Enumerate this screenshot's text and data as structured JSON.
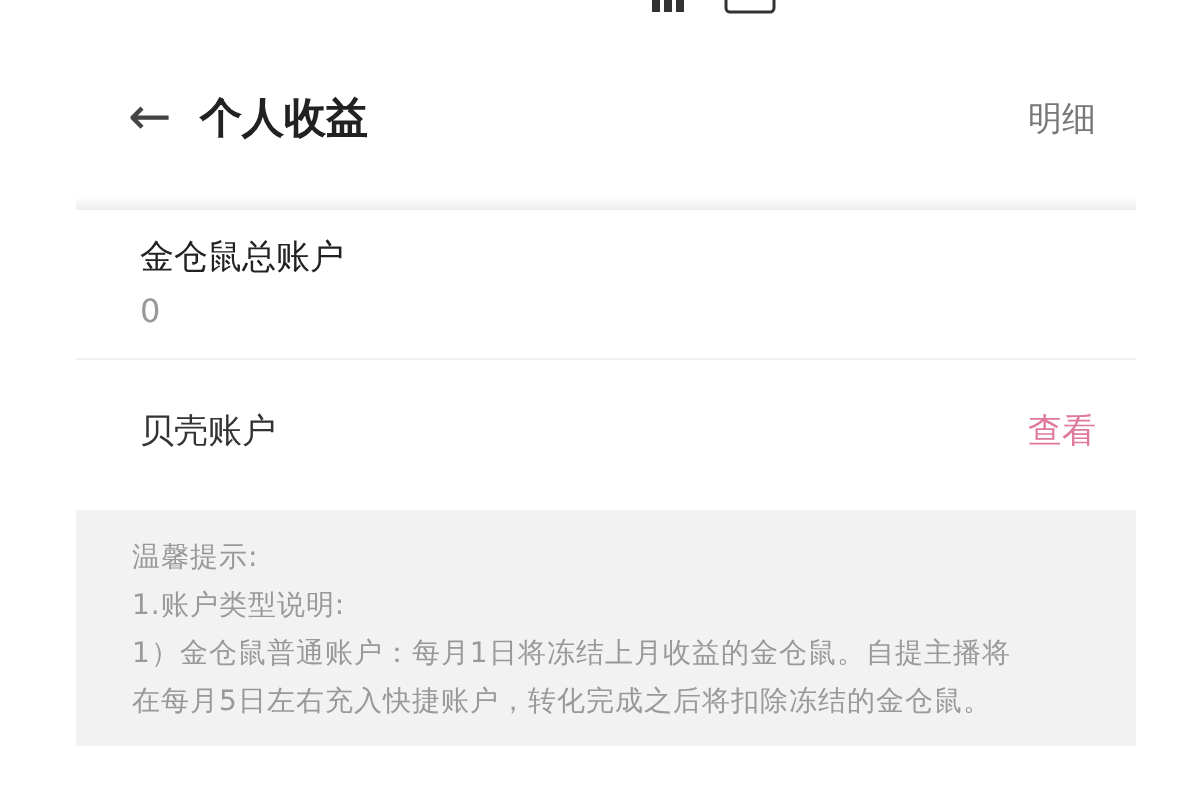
{
  "header": {
    "back": "←",
    "title": "个人收益",
    "action": "明细"
  },
  "accounts": [
    {
      "kind": "balance",
      "name": "金仓鼠总账户",
      "value": "0"
    },
    {
      "kind": "link",
      "name": "贝壳账户",
      "action": "查看"
    }
  ],
  "tips": {
    "title": "温馨提示:",
    "lines": [
      "1.账户类型说明:",
      "1）金仓鼠普通账户：每月1日将冻结上月收益的金仓鼠。自提主播将在每月5日左右充入快捷账户，转化完成之后将扣除冻结的金仓鼠。"
    ]
  }
}
